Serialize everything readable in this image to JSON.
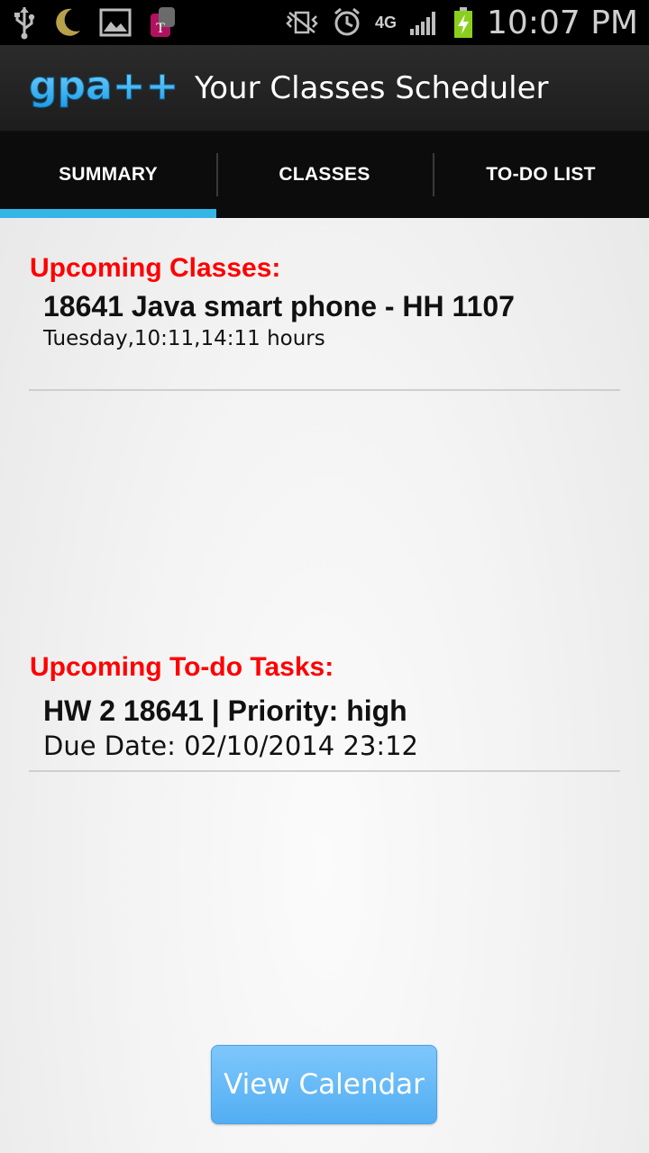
{
  "status_bar": {
    "time": "10:07 PM",
    "network_type": "4G",
    "icons": [
      "usb-icon",
      "moon-icon",
      "image-icon",
      "tmobile-icon",
      "vibrate-icon",
      "alarm-icon",
      "signal-icon",
      "battery-charging-icon"
    ]
  },
  "action_bar": {
    "logo_text": "gpa++",
    "title": "Your Classes Scheduler"
  },
  "tabs": [
    {
      "label": "SUMMARY",
      "active": true
    },
    {
      "label": "CLASSES",
      "active": false
    },
    {
      "label": "TO-DO LIST",
      "active": false
    }
  ],
  "upcoming_classes": {
    "heading": "Upcoming Classes:",
    "items": [
      {
        "title": "18641 Java smart phone - HH 1107",
        "subtitle": "Tuesday,10:11,14:11 hours"
      }
    ]
  },
  "upcoming_tasks": {
    "heading": "Upcoming To-do Tasks:",
    "items": [
      {
        "title": "HW 2 18641 | Priority: high",
        "subtitle": "Due Date: 02/10/2014 23:12"
      }
    ]
  },
  "buttons": {
    "view_calendar": "View Calendar"
  },
  "colors": {
    "accent": "#33b5e5",
    "heading_red": "#ff0000",
    "button_blue": "#5fb6f5"
  }
}
